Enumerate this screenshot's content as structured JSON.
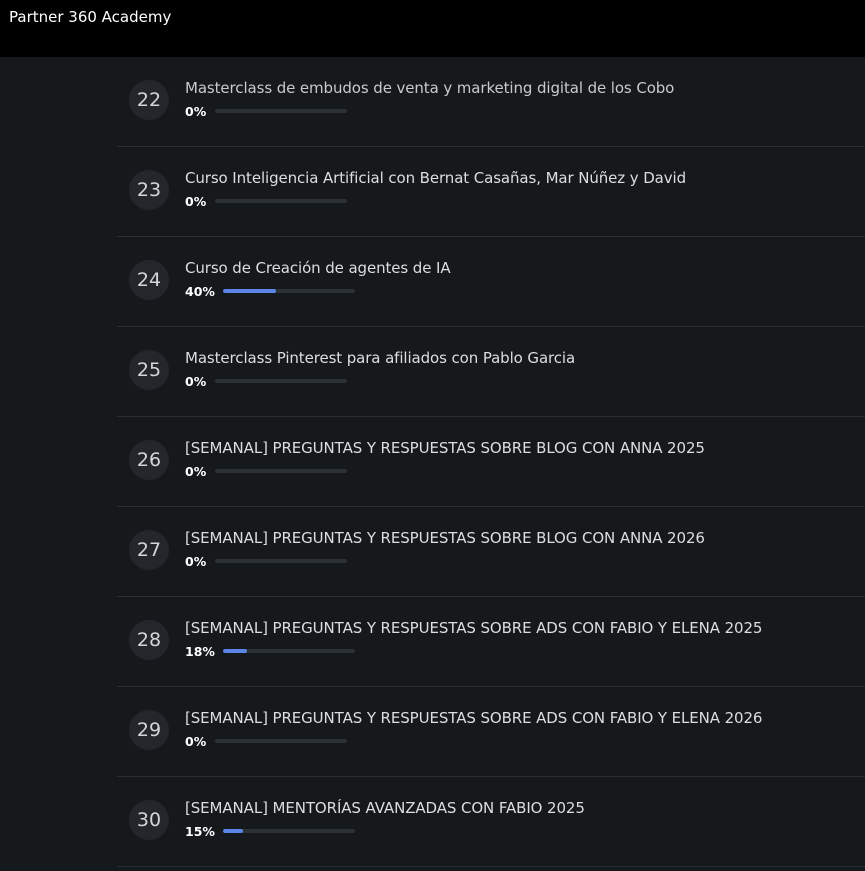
{
  "app": {
    "title": "Partner 360 Academy"
  },
  "colors": {
    "background": "#16191c",
    "topbar": "#000000",
    "accent": "#5b86e5"
  },
  "courses": [
    {
      "number": "22",
      "title": "Masterclass de embudos de venta y marketing digital de los Cobo",
      "progress_label": "0%",
      "progress": 0
    },
    {
      "number": "23",
      "title": "Curso Inteligencia Artificial con Bernat Casañas, Mar Núñez y David",
      "progress_label": "0%",
      "progress": 0
    },
    {
      "number": "24",
      "title": "Curso de Creación de agentes de IA",
      "progress_label": "40%",
      "progress": 40
    },
    {
      "number": "25",
      "title": "Masterclass Pinterest para afiliados con Pablo Garcia",
      "progress_label": "0%",
      "progress": 0
    },
    {
      "number": "26",
      "title": "[SEMANAL] PREGUNTAS Y RESPUESTAS SOBRE BLOG CON ANNA 2025",
      "progress_label": "0%",
      "progress": 0
    },
    {
      "number": "27",
      "title": "[SEMANAL] PREGUNTAS Y RESPUESTAS SOBRE BLOG CON ANNA 2026",
      "progress_label": "0%",
      "progress": 0
    },
    {
      "number": "28",
      "title": "[SEMANAL] PREGUNTAS Y RESPUESTAS SOBRE ADS CON FABIO Y ELENA 2025",
      "progress_label": "18%",
      "progress": 18
    },
    {
      "number": "29",
      "title": "[SEMANAL] PREGUNTAS Y RESPUESTAS SOBRE ADS CON FABIO Y ELENA 2026",
      "progress_label": "0%",
      "progress": 0
    },
    {
      "number": "30",
      "title": "[SEMANAL] MENTORÍAS AVANZADAS CON FABIO 2025",
      "progress_label": "15%",
      "progress": 15
    }
  ]
}
